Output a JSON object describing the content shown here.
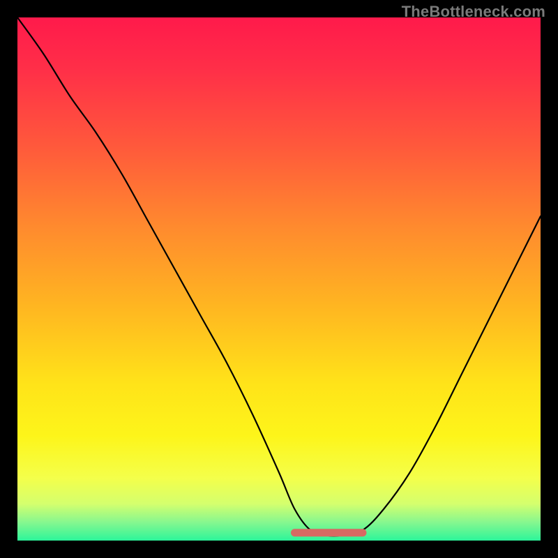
{
  "watermark": "TheBottleneck.com",
  "colors": {
    "gradient_stops": [
      {
        "offset": 0.0,
        "color": "#ff1a4b"
      },
      {
        "offset": 0.1,
        "color": "#ff2f48"
      },
      {
        "offset": 0.25,
        "color": "#ff5a3b"
      },
      {
        "offset": 0.4,
        "color": "#ff8a2e"
      },
      {
        "offset": 0.55,
        "color": "#ffb521"
      },
      {
        "offset": 0.7,
        "color": "#ffe319"
      },
      {
        "offset": 0.8,
        "color": "#fdf51a"
      },
      {
        "offset": 0.88,
        "color": "#f4ff4a"
      },
      {
        "offset": 0.93,
        "color": "#d4ff6e"
      },
      {
        "offset": 0.965,
        "color": "#86f78f"
      },
      {
        "offset": 1.0,
        "color": "#2cf59a"
      }
    ],
    "curve": "#000000",
    "bottom_marker": "#d76a63",
    "frame": "#000000"
  },
  "chart_data": {
    "type": "line",
    "title": "",
    "xlabel": "",
    "ylabel": "",
    "xlim": [
      0,
      100
    ],
    "ylim": [
      0,
      100
    ],
    "grid": false,
    "legend": false,
    "annotations": [
      "TheBottleneck.com"
    ],
    "series": [
      {
        "name": "bottleneck-curve",
        "x": [
          0,
          5,
          10,
          15,
          20,
          25,
          30,
          35,
          40,
          45,
          50,
          53,
          56,
          59,
          62,
          66,
          70,
          75,
          80,
          85,
          90,
          95,
          100
        ],
        "y": [
          100,
          93,
          85,
          78,
          70,
          61,
          52,
          43,
          34,
          24,
          13,
          6,
          2,
          1,
          1,
          2,
          6,
          13,
          22,
          32,
          42,
          52,
          62
        ]
      },
      {
        "name": "optimal-band",
        "x": [
          53,
          66
        ],
        "y": [
          1.5,
          1.5
        ]
      }
    ],
    "notes": "V-shaped bottleneck curve over vertical green-to-red gradient; minimum (optimal zone) roughly between x≈53 and x≈66 where y is near 0."
  }
}
